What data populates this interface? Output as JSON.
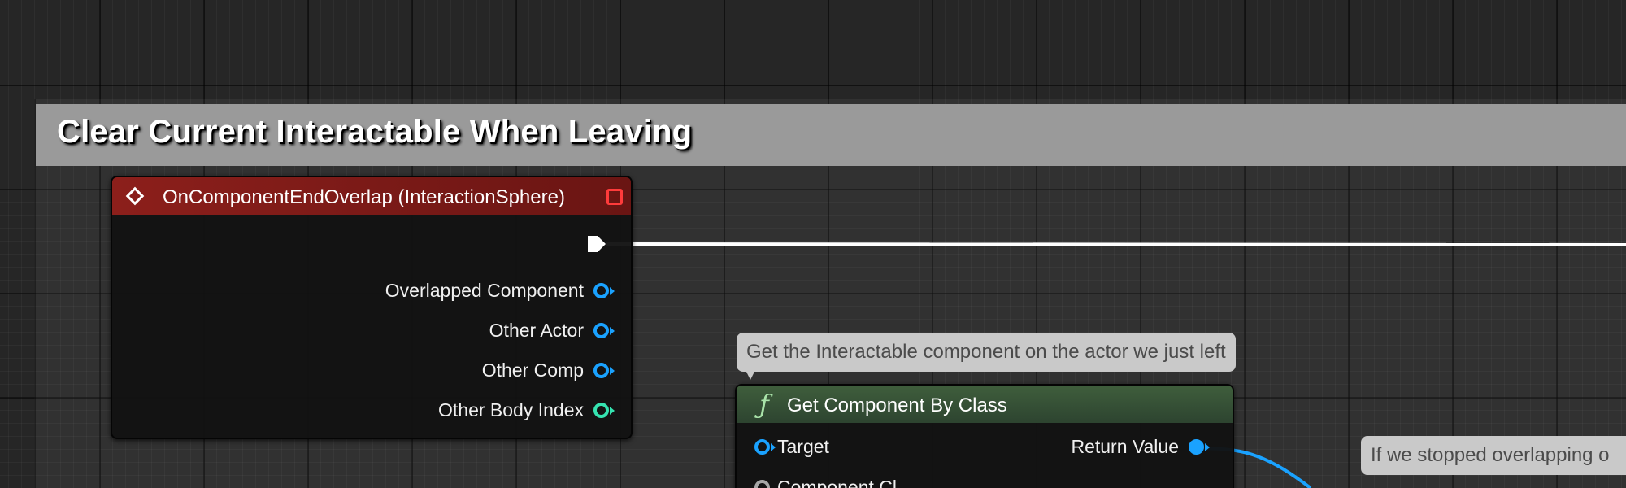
{
  "comment": {
    "title": "Clear Current Interactable When Leaving"
  },
  "event_node": {
    "title": "OnComponentEndOverlap (InteractionSphere)",
    "outputs": [
      {
        "label": "Overlapped Component",
        "pin_type": "object"
      },
      {
        "label": "Other Actor",
        "pin_type": "object"
      },
      {
        "label": "Other Comp",
        "pin_type": "object"
      },
      {
        "label": "Other Body Index",
        "pin_type": "integer"
      }
    ]
  },
  "function_node": {
    "comment": "Get the Interactable component on the actor we just left",
    "title": "Get Component By Class",
    "inputs": [
      {
        "label": "Target"
      },
      {
        "label": "Component Cl"
      }
    ],
    "outputs": [
      {
        "label": "Return Value"
      }
    ]
  },
  "right_comment": {
    "text": "If we stopped overlapping o"
  },
  "colors": {
    "event_header": "#8c1f1b",
    "function_header": "#3f5e3c",
    "object_pin": "#1aa2ff",
    "integer_pin": "#35e3b0",
    "exec_wire": "#ffffff",
    "comment_header": "#9a9a9a"
  }
}
